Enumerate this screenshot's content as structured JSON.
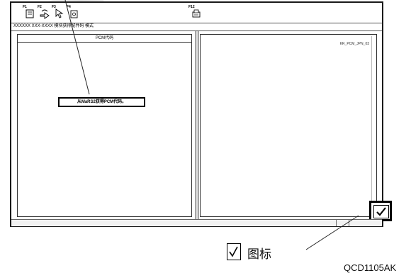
{
  "toolbar": {
    "buttons": [
      {
        "key": "F1",
        "icon": "document-icon"
      },
      {
        "key": "F2",
        "icon": "back-arrow-icon"
      },
      {
        "key": "F3",
        "icon": "pointer-icon"
      },
      {
        "key": "F4",
        "icon": "exit-icon"
      },
      {
        "key": "F12",
        "icon": "print-icon"
      }
    ]
  },
  "caption": "XXXXXX XXX-XXXX 模块获得配件码 模式",
  "left_pane": {
    "header": "PCM代码"
  },
  "right_pane": {
    "file_label": "KR_PCM_JPN_03"
  },
  "note": "从MaRS2获得PCM代码。",
  "check_icon": "checkmark-icon",
  "legend": {
    "symbol": "√",
    "text": "图标"
  },
  "figure_code": "QCD1105AK"
}
